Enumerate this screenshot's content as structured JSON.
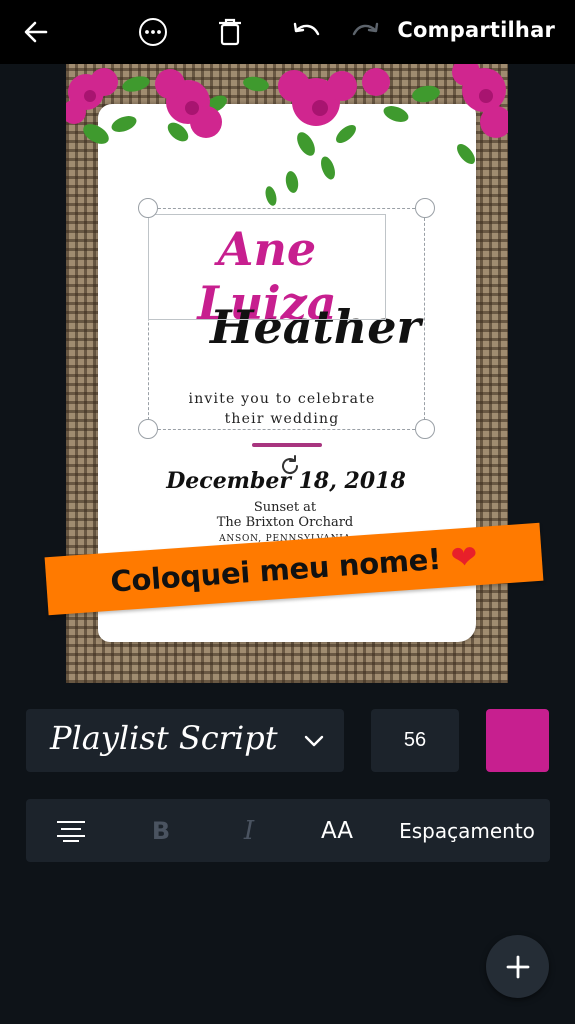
{
  "toolbar": {
    "back_icon": "arrow-left-icon",
    "more_icon": "more-horizontal-icon",
    "delete_icon": "trash-icon",
    "undo_icon": "undo-icon",
    "redo_icon": "redo-icon",
    "share_label": "Compartilhar"
  },
  "design": {
    "name_line1": "Ane Luiza",
    "name_line2": "Heather",
    "invite_line1": "invite you to celebrate",
    "invite_line2": "their wedding",
    "date": "December 18, 2018",
    "time": "Sunset at",
    "venue": "The Brixton Orchard",
    "location": "ANSON, PENNSYLVANIA",
    "accent_color": "#c71f8f"
  },
  "overlay": {
    "banner_text": "Coloquei meu nome!",
    "banner_emoji": "❤",
    "banner_color": "#ff7a00"
  },
  "text_controls": {
    "font_name": "Playlist Script",
    "font_size": "56",
    "color": "#c71f8f",
    "bold_label": "B",
    "italic_label": "I",
    "case_label": "AA",
    "spacing_label": "Espaçamento"
  },
  "fab": {
    "icon": "plus-icon"
  }
}
